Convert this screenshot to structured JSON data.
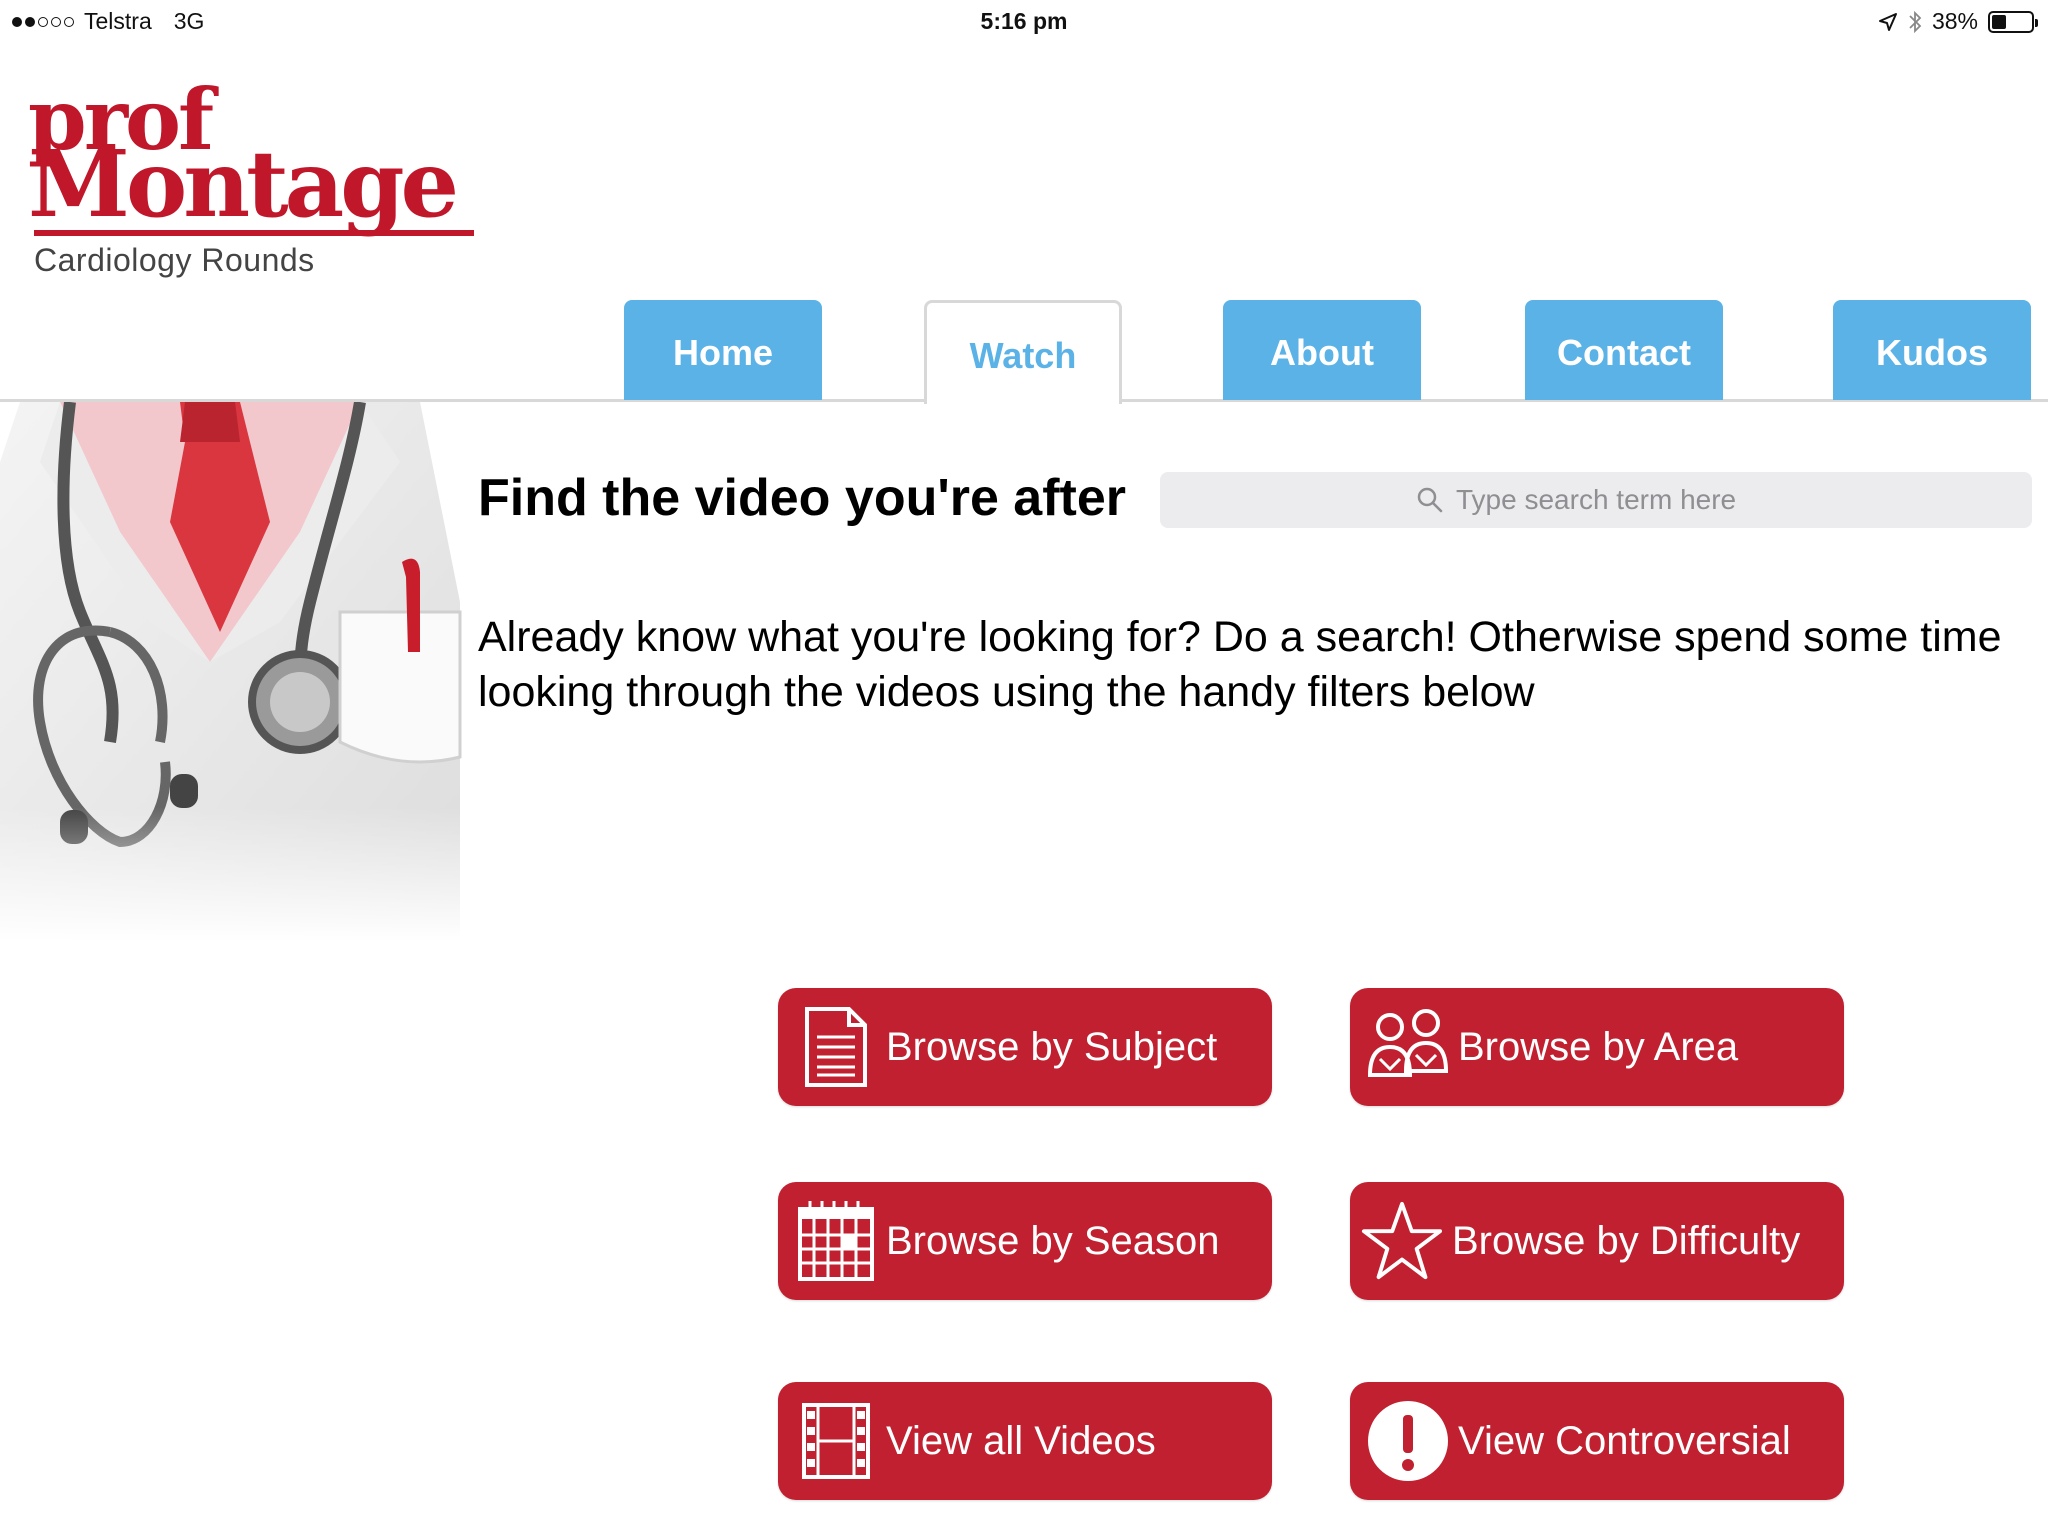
{
  "status_bar": {
    "carrier": "Telstra",
    "network": "3G",
    "time": "5:16 pm",
    "battery": "38%",
    "battery_level": 0.38
  },
  "logo": {
    "line1": "prof",
    "line2": "Montage",
    "subtitle": "Cardiology  Rounds"
  },
  "nav": {
    "tabs": [
      {
        "label": "Home"
      },
      {
        "label": "Watch"
      },
      {
        "label": "About"
      },
      {
        "label": "Contact"
      },
      {
        "label": "Kudos"
      }
    ],
    "active": "Watch"
  },
  "main": {
    "heading": "Find the video you're after",
    "search_placeholder": "Type search term here",
    "intro": "Already know what you're looking for? Do a search! Otherwise spend some time looking through the videos using the handy filters below"
  },
  "buttons": [
    {
      "label": "Browse by Subject",
      "icon": "document-icon"
    },
    {
      "label": "Browse by Area",
      "icon": "people-icon"
    },
    {
      "label": "Browse by Season",
      "icon": "calendar-icon"
    },
    {
      "label": "Browse by Difficulty",
      "icon": "star-icon"
    },
    {
      "label": "View all Videos",
      "icon": "film-icon"
    },
    {
      "label": "View Controversial",
      "icon": "exclamation-icon"
    }
  ],
  "colors": {
    "brand_red": "#c0172b",
    "button_red": "#c0202f",
    "tab_blue": "#5ab2e6"
  }
}
